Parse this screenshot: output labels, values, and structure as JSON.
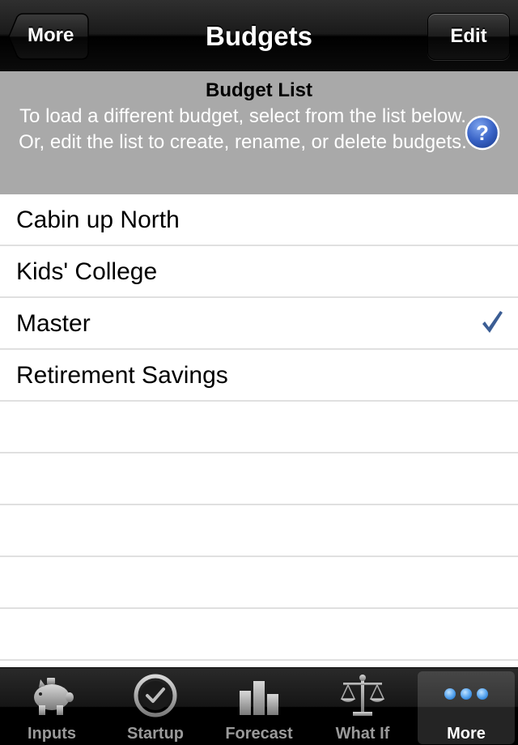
{
  "nav": {
    "back_label": "More",
    "title": "Budgets",
    "edit_label": "Edit"
  },
  "info": {
    "title": "Budget List",
    "text": "To load a different budget, select from the list below. Or, edit the list to create, rename, or delete budgets.",
    "help_icon": "question-mark-circle-icon"
  },
  "budgets": [
    {
      "name": "Cabin up North",
      "selected": false
    },
    {
      "name": "Kids' College",
      "selected": false
    },
    {
      "name": "Master",
      "selected": true
    },
    {
      "name": "Retirement Savings",
      "selected": false
    }
  ],
  "tabs": [
    {
      "label": "Inputs",
      "icon": "piggy-bank-icon",
      "active": false
    },
    {
      "label": "Startup",
      "icon": "clock-icon",
      "active": false
    },
    {
      "label": "Forecast",
      "icon": "bar-chart-icon",
      "active": false
    },
    {
      "label": "What If",
      "icon": "balance-scale-icon",
      "active": false
    },
    {
      "label": "More",
      "icon": "more-dots-icon",
      "active": true
    }
  ],
  "colors": {
    "checkmark": "#3b5d94",
    "help": "#3a64c7",
    "info_bg": "#a9a9a9",
    "more_dots": "#5fa9f0"
  }
}
